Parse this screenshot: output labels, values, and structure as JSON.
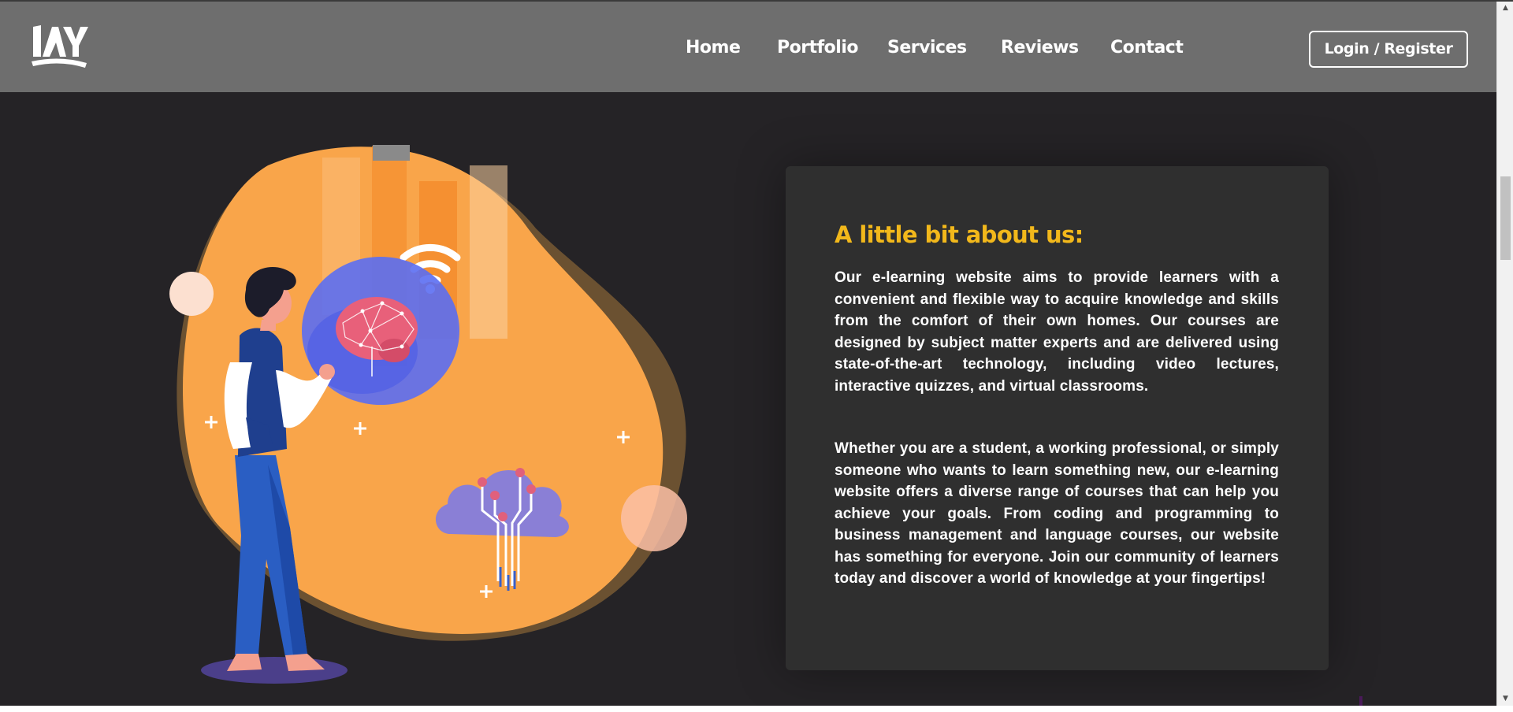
{
  "nav": {
    "logo_text": "IAY",
    "links": [
      "Home",
      "Portfolio",
      "Services",
      "Reviews",
      "Contact"
    ],
    "login_label": "Login / Register"
  },
  "about": {
    "title": "A little bit about us:",
    "paragraphs": [
      "Our e-learning website aims to provide learners with a convenient and flexible way to acquire knowledge and skills from the comfort of their own homes. Our courses are designed by subject matter experts and are delivered using state-of-the-art technology, including video lectures, interactive quizzes, and virtual classrooms.",
      "Whether you are a student, a working professional, or simply someone who wants to learn something new, our e-learning website offers a diverse range of courses that can help you achieve your goals. From coding and programming to business management and language courses, our website has something for everyone. Join our community of learners today and discover a world of knowledge at your fingertips!"
    ]
  },
  "colors": {
    "navbar": "#6e6e6e",
    "page_background": "#252326",
    "card_background": "#2f2f2f",
    "accent_title": "#f2b81b",
    "blob_orange": "#f9a54a"
  },
  "icons": {
    "logo": "brand-logo-icon",
    "illustration": "elearning-illustration"
  }
}
